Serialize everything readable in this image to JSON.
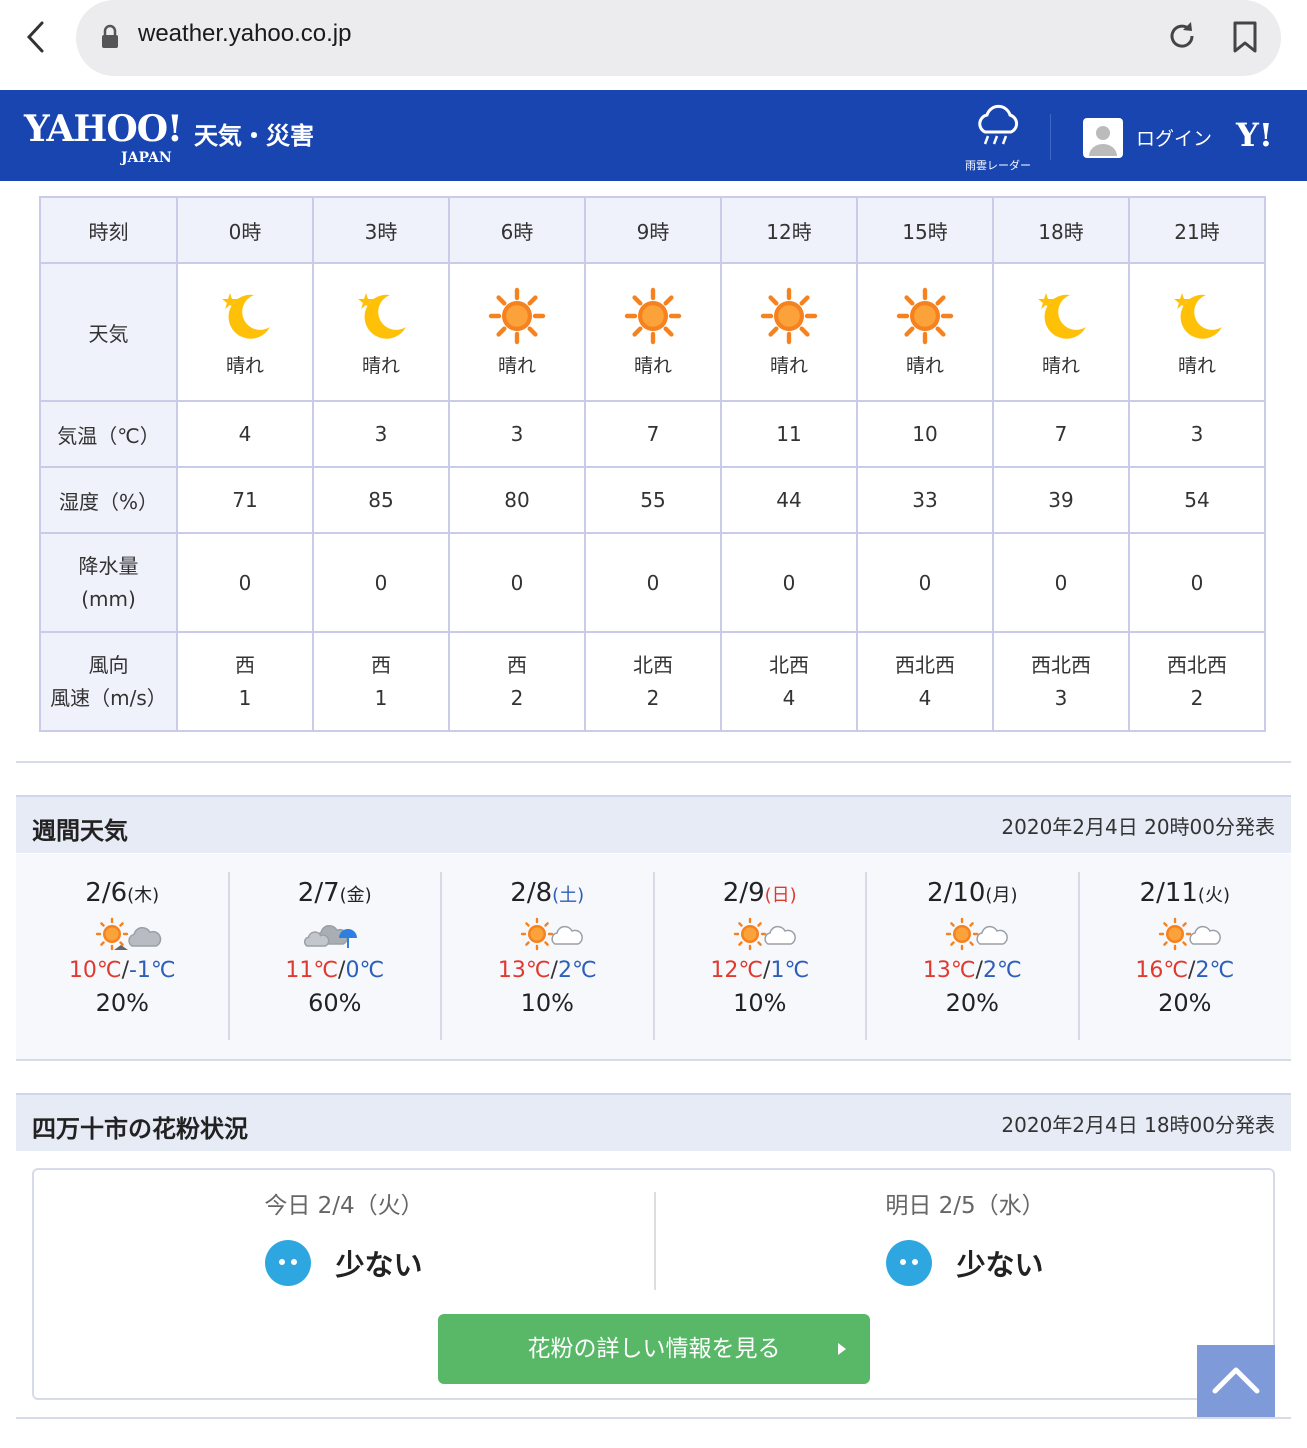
{
  "browser": {
    "url": "weather.yahoo.co.jp"
  },
  "header": {
    "logo_main": "YAHOO!",
    "logo_sub": "JAPAN",
    "logo_title": "天気・災害",
    "radar_label": "雨雲レーダー",
    "login_label": "ログイン",
    "y_logo": "Y!"
  },
  "hourly": {
    "row_labels": {
      "time": "時刻",
      "weather": "天気",
      "temp": "気温（℃）",
      "humidity": "湿度（%）",
      "precip_1": "降水量",
      "precip_2": "(mm)",
      "wind_1": "風向",
      "wind_2": "風速（m/s）"
    },
    "columns": [
      {
        "time": "0時",
        "icon": "moon-icon",
        "weather": "晴れ",
        "temp": "4",
        "humidity": "71",
        "precip": "0",
        "wind_dir": "西",
        "wind_speed": "1"
      },
      {
        "time": "3時",
        "icon": "moon-icon",
        "weather": "晴れ",
        "temp": "3",
        "humidity": "85",
        "precip": "0",
        "wind_dir": "西",
        "wind_speed": "1"
      },
      {
        "time": "6時",
        "icon": "sun-icon",
        "weather": "晴れ",
        "temp": "3",
        "humidity": "80",
        "precip": "0",
        "wind_dir": "西",
        "wind_speed": "2"
      },
      {
        "time": "9時",
        "icon": "sun-icon",
        "weather": "晴れ",
        "temp": "7",
        "humidity": "55",
        "precip": "0",
        "wind_dir": "北西",
        "wind_speed": "2"
      },
      {
        "time": "12時",
        "icon": "sun-icon",
        "weather": "晴れ",
        "temp": "11",
        "humidity": "44",
        "precip": "0",
        "wind_dir": "北西",
        "wind_speed": "4"
      },
      {
        "time": "15時",
        "icon": "sun-icon",
        "weather": "晴れ",
        "temp": "10",
        "humidity": "33",
        "precip": "0",
        "wind_dir": "西北西",
        "wind_speed": "4"
      },
      {
        "time": "18時",
        "icon": "moon-icon",
        "weather": "晴れ",
        "temp": "7",
        "humidity": "39",
        "precip": "0",
        "wind_dir": "西北西",
        "wind_speed": "3"
      },
      {
        "time": "21時",
        "icon": "moon-icon",
        "weather": "晴れ",
        "temp": "3",
        "humidity": "54",
        "precip": "0",
        "wind_dir": "西北西",
        "wind_speed": "2"
      }
    ]
  },
  "weekly": {
    "title": "週間天気",
    "published": "2020年2月4日 20時00分発表",
    "days": [
      {
        "date": "2/6",
        "dow": "(木)",
        "dow_color": "normal",
        "icon": "sun-then-cloud-icon",
        "hi": "10℃",
        "lo": "-1℃",
        "prob": "20%"
      },
      {
        "date": "2/7",
        "dow": "(金)",
        "dow_color": "normal",
        "icon": "cloud-umbrella-icon",
        "hi": "11℃",
        "lo": "0℃",
        "prob": "60%"
      },
      {
        "date": "2/8",
        "dow": "(土)",
        "dow_color": "sat",
        "icon": "sun-cloud-icon",
        "hi": "13℃",
        "lo": "2℃",
        "prob": "10%"
      },
      {
        "date": "2/9",
        "dow": "(日)",
        "dow_color": "sun",
        "icon": "sun-cloud-icon",
        "hi": "12℃",
        "lo": "1℃",
        "prob": "10%"
      },
      {
        "date": "2/10",
        "dow": "(月)",
        "dow_color": "normal",
        "icon": "sun-cloud-icon",
        "hi": "13℃",
        "lo": "2℃",
        "prob": "20%"
      },
      {
        "date": "2/11",
        "dow": "(火)",
        "dow_color": "normal",
        "icon": "sun-cloud-icon",
        "hi": "16℃",
        "lo": "2℃",
        "prob": "20%"
      }
    ]
  },
  "pollen": {
    "title": "四万十市の花粉状況",
    "published": "2020年2月4日 18時00分発表",
    "today": {
      "date": "今日 2/4（火）",
      "level": "少ない"
    },
    "tomorrow": {
      "date": "明日 2/5（水）",
      "level": "少ない"
    },
    "button_label": "花粉の詳しい情報を見る"
  },
  "colors": {
    "header_bg": "#1845b0",
    "hi_temp": "#e03a2f",
    "lo_temp": "#2d5fb8",
    "pollen_button": "#59b868",
    "pollen_face": "#2ea7e0"
  }
}
